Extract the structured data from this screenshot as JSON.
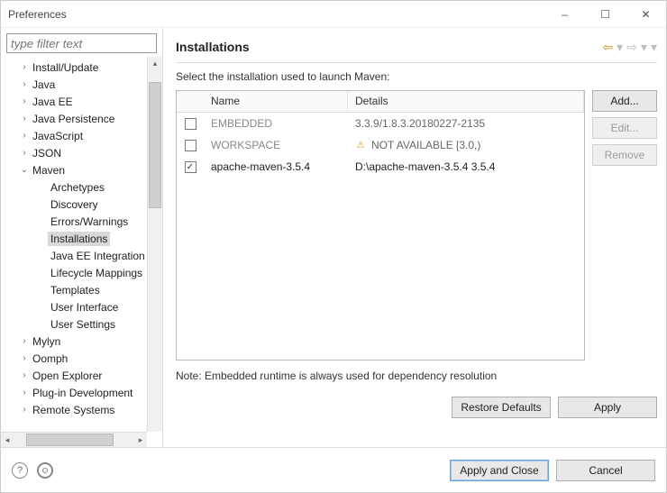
{
  "window": {
    "title": "Preferences"
  },
  "filter": {
    "placeholder": "type filter text"
  },
  "tree": {
    "items": [
      {
        "label": "Install/Update",
        "depth": 1,
        "expandable": true,
        "expanded": false
      },
      {
        "label": "Java",
        "depth": 1,
        "expandable": true,
        "expanded": false
      },
      {
        "label": "Java EE",
        "depth": 1,
        "expandable": true,
        "expanded": false
      },
      {
        "label": "Java Persistence",
        "depth": 1,
        "expandable": true,
        "expanded": false
      },
      {
        "label": "JavaScript",
        "depth": 1,
        "expandable": true,
        "expanded": false
      },
      {
        "label": "JSON",
        "depth": 1,
        "expandable": true,
        "expanded": false
      },
      {
        "label": "Maven",
        "depth": 1,
        "expandable": true,
        "expanded": true
      },
      {
        "label": "Archetypes",
        "depth": 2,
        "expandable": false
      },
      {
        "label": "Discovery",
        "depth": 2,
        "expandable": false
      },
      {
        "label": "Errors/Warnings",
        "depth": 2,
        "expandable": false
      },
      {
        "label": "Installations",
        "depth": 2,
        "expandable": false,
        "selected": true
      },
      {
        "label": "Java EE Integration",
        "depth": 2,
        "expandable": false
      },
      {
        "label": "Lifecycle Mappings",
        "depth": 2,
        "expandable": false
      },
      {
        "label": "Templates",
        "depth": 2,
        "expandable": false
      },
      {
        "label": "User Interface",
        "depth": 2,
        "expandable": false
      },
      {
        "label": "User Settings",
        "depth": 2,
        "expandable": false
      },
      {
        "label": "Mylyn",
        "depth": 1,
        "expandable": true,
        "expanded": false
      },
      {
        "label": "Oomph",
        "depth": 1,
        "expandable": true,
        "expanded": false
      },
      {
        "label": "Open Explorer",
        "depth": 1,
        "expandable": true,
        "expanded": false
      },
      {
        "label": "Plug-in Development",
        "depth": 1,
        "expandable": true,
        "expanded": false
      },
      {
        "label": "Remote Systems",
        "depth": 1,
        "expandable": true,
        "expanded": false
      }
    ]
  },
  "page": {
    "heading": "Installations",
    "instruction": "Select the installation used to launch Maven:",
    "columns": {
      "name": "Name",
      "details": "Details"
    },
    "rows": [
      {
        "checked": false,
        "name": "EMBEDDED",
        "details": "3.3.9/1.8.3.20180227-2135",
        "muted": true,
        "warn": false
      },
      {
        "checked": false,
        "name": "WORKSPACE",
        "details": "NOT AVAILABLE [3.0,)",
        "muted": true,
        "warn": true
      },
      {
        "checked": true,
        "name": "apache-maven-3.5.4",
        "details": "D:\\apache-maven-3.5.4 3.5.4",
        "muted": false,
        "warn": false
      }
    ],
    "buttons": {
      "add": "Add...",
      "edit": "Edit...",
      "remove": "Remove"
    },
    "note": "Note: Embedded runtime is always used for dependency resolution",
    "restore": "Restore Defaults",
    "apply": "Apply"
  },
  "footer": {
    "apply_close": "Apply and Close",
    "cancel": "Cancel"
  }
}
